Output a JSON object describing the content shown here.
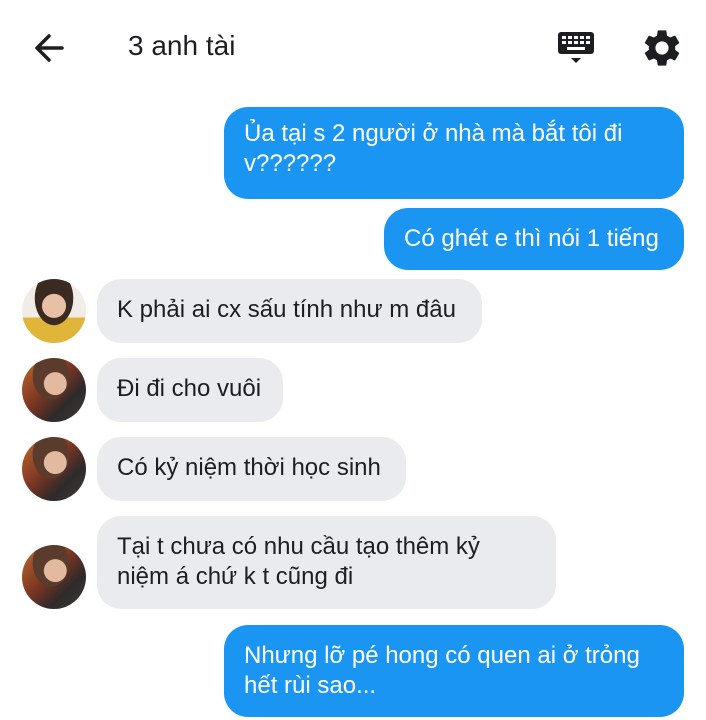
{
  "header": {
    "title": "3 anh tài"
  },
  "icons": {
    "back": "arrow-back-icon",
    "keyboard": "keyboard-icon",
    "settings": "gear-icon"
  },
  "colors": {
    "outgoing_bubble": "#1a95f2",
    "incoming_bubble": "#e9ebee"
  },
  "messages": [
    {
      "direction": "outgoing",
      "text": "Ủa tại s 2 người ở nhà mà bắt tôi đi\nv??????"
    },
    {
      "direction": "outgoing",
      "text": "Có ghét e thì nói 1 tiếng"
    },
    {
      "direction": "incoming",
      "text": "K phải ai cx sấu tính như m đâu"
    },
    {
      "direction": "incoming",
      "text": "Đi đi cho vuôi"
    },
    {
      "direction": "incoming",
      "text": "Có kỷ niệm thời học sinh"
    },
    {
      "direction": "incoming",
      "text": "Tại t chưa có nhu cầu tạo thêm kỷ\nniệm á chứ k t cũng đi"
    },
    {
      "direction": "outgoing",
      "text": "Nhưng lỡ pé hong có quen ai ở trỏng\nhết rùi sao..."
    }
  ]
}
